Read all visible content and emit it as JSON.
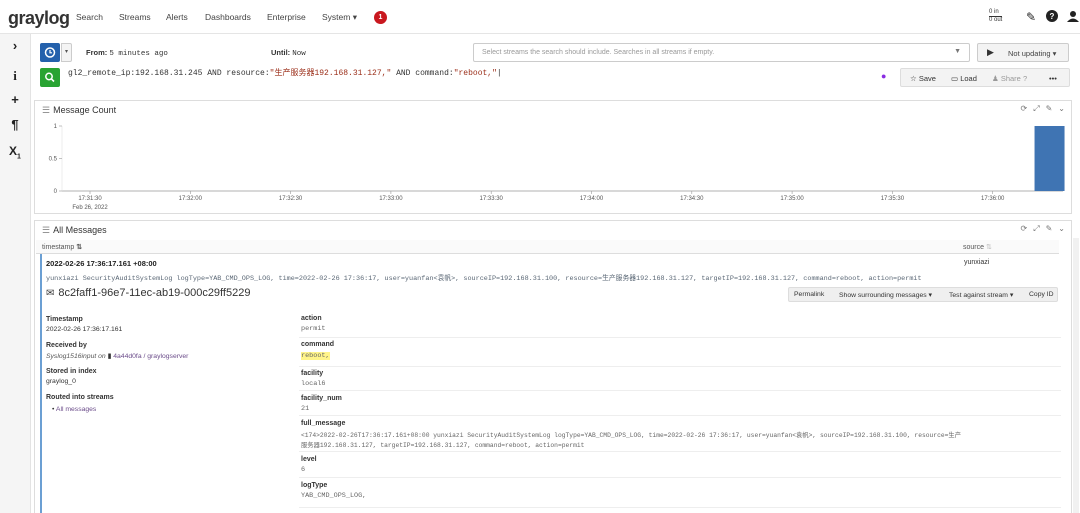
{
  "nav": {
    "logo": "graylog",
    "items": [
      "Search",
      "Streams",
      "Alerts",
      "Dashboards",
      "Enterprise",
      "System ▾"
    ],
    "badge": "1",
    "io_in": "0 in",
    "io_out": "0 out"
  },
  "sidebar": {
    "icons": [
      "chevron-right-icon",
      "info-icon",
      "plus-icon",
      "pilcrow-icon",
      "x-subscript-icon"
    ]
  },
  "search": {
    "from_label": "From:",
    "from_value": "5 minutes ago",
    "until_label": "Until:",
    "until_value": "Now",
    "stream_placeholder": "Select streams the search should include. Searches in all streams if empty.",
    "updating_label": "Not updating ▾",
    "query_parts": [
      {
        "t": "k",
        "v": "gl2_remote_ip:192.168.31.245 AND resource:"
      },
      {
        "t": "s",
        "v": "\"生产服务器192.168.31.127,\""
      },
      {
        "t": "k",
        "v": " AND command:"
      },
      {
        "t": "s",
        "v": "\"reboot,\""
      }
    ],
    "save_label": "Save",
    "load_label": "Load",
    "share_label": "Share",
    "more_label": "•••"
  },
  "message_count": {
    "title": "Message Count"
  },
  "chart_data": {
    "type": "bar",
    "x_ticks": [
      "17:31:30",
      "17:32:00",
      "17:32:30",
      "17:33:00",
      "17:33:30",
      "17:34:00",
      "17:34:30",
      "17:35:00",
      "17:35:30",
      "17:36:00"
    ],
    "x_subtick": "Feb 26, 2022",
    "y_ticks": [
      "1",
      "0.5",
      "0"
    ],
    "ylim": [
      0,
      1
    ],
    "bars": [
      {
        "x": "17:36:17",
        "value": 1
      }
    ],
    "bar_color": "#3f74b3"
  },
  "all_messages": {
    "title": "All Messages",
    "col_timestamp": "timestamp",
    "col_source": "source",
    "row": {
      "timestamp": "2022-02-26 17:36:17.161 +08:00",
      "source": "yunxiazi",
      "message": "yunxiazi SecurityAuditSystemLog logType=YAB_CMD_OPS_LOG, time=2022-02-26 17:36:17, user=yuanfan<袁帆>, sourceIP=192.168.31.100, resource=生产服务器192.168.31.127, targetIP=192.168.31.127, command=reboot, action=permit",
      "id": "8c2faff1-96e7-11ec-ab19-000c29ff5229",
      "btn_permalink": "Permalink",
      "btn_surrounding": "Show surrounding messages ▾",
      "btn_test": "Test against stream ▾",
      "btn_copy": "Copy ID",
      "meta": {
        "timestamp_label": "Timestamp",
        "timestamp_value": "2022-02-26 17:36:17.161",
        "received_label": "Received by",
        "received_input": "Syslog1516input",
        "received_on": "on",
        "received_node": "4a44d0fa / graylogserver",
        "stored_label": "Stored in index",
        "stored_value": "graylog_0",
        "routed_label": "Routed into streams",
        "routed_value": "All messages"
      },
      "fields": [
        {
          "name": "action",
          "value": "permit"
        },
        {
          "name": "command",
          "value": "reboot,"
        },
        {
          "name": "facility",
          "value": "local6"
        },
        {
          "name": "facility_num",
          "value": "21"
        },
        {
          "name": "full_message",
          "value": "<174>2022-02-26T17:36:17.161+08:00 yunxiazi SecurityAuditSystemLog logType=YAB_CMD_OPS_LOG, time=2022-02-26 17:36:17, user=yuanfan<袁帆>, sourceIP=192.168.31.100, resource=生产",
          "value2": "服务器192.168.31.127, targetIP=192.168.31.127, command=reboot, action=permit"
        },
        {
          "name": "level",
          "value": "6"
        },
        {
          "name": "logType",
          "value": "YAB_CMD_OPS_LOG,"
        }
      ]
    }
  }
}
